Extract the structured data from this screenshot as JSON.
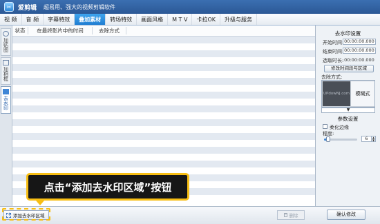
{
  "app": {
    "name": "爱剪辑",
    "slogan": "超易用、强大的视频剪辑软件",
    "icon": "scissors-app-icon",
    "accent": "#1f7dd1"
  },
  "menu": [
    {
      "label": "视 频",
      "active": false
    },
    {
      "label": "音 频",
      "active": false
    },
    {
      "label": "字幕特效",
      "active": false
    },
    {
      "label": "叠加素材",
      "active": true
    },
    {
      "label": "转场特效",
      "active": false
    },
    {
      "label": "画面风格",
      "active": false
    },
    {
      "label": "M T V",
      "active": false
    },
    {
      "label": "卡拉OK",
      "active": false
    },
    {
      "label": "升级与服务",
      "active": false
    }
  ],
  "side_tabs": [
    {
      "label": "加贴图",
      "icon": "sticker-icon",
      "active": false
    },
    {
      "label": "加相框",
      "icon": "frame-icon",
      "active": false
    },
    {
      "label": "去水印",
      "icon": "watermark-remove-icon",
      "active": true
    }
  ],
  "table": {
    "columns": [
      "状态",
      "在最终影片中的时间",
      "去除方式"
    ],
    "rows": []
  },
  "watermark_settings": {
    "title": "去水印设置",
    "start_label": "开始时间:",
    "start_value": "00:00:00.000",
    "end_label": "结束时间:",
    "end_value": "00:00:00.000",
    "duration_label": "选取时长:",
    "duration_value": "00:00:00.000",
    "modify_button": "修改时间段与区域",
    "method_label": "去除方式:",
    "method_value": "模糊式",
    "preview_text": "UPdowNJ.com",
    "dropdown_glyph": "▼"
  },
  "params": {
    "title": "参数设置",
    "soften_label": "柔化边缘",
    "soften_checked": false,
    "degree_label": "程度:",
    "degree_value": "6",
    "degree_fraction": 0.12
  },
  "bottom": {
    "add_button": "添加去水印区域",
    "delete_button": "删除",
    "confirm_button": "确认修改"
  },
  "callout": {
    "text": "点击“添加去水印区域”按钮",
    "border_color": "#f7be14"
  }
}
